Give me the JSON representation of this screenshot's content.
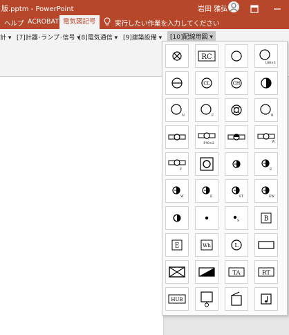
{
  "window": {
    "doc_title": "版.pptm  -  PowerPoint",
    "user_name": "岩田 雅弘"
  },
  "tabs": [
    {
      "label": "ヘルプ"
    },
    {
      "label": "ACROBAT"
    },
    {
      "label": "電気図記号"
    }
  ],
  "tell_me": "実行したい作業を入力してください",
  "ribbon_groups": [
    {
      "label": "計 ▾"
    },
    {
      "label": "[7]計器･ランプ･信号 ▾"
    },
    {
      "label": "[8]電気通信 ▾"
    },
    {
      "label": "[9]建築設備 ▾"
    },
    {
      "label": "[10]配線用図 ▾"
    }
  ],
  "symbol_labels": {
    "rc": "RC",
    "n100x3": "100×3",
    "cl": "CL",
    "ch": "CH",
    "sub_n": "N",
    "sub_f": "F",
    "sub_r": "R",
    "f40x2": "F40×2",
    "sub_w": "W",
    "sub_e": "E",
    "sub_et": "ET",
    "sub_ew": "EW",
    "sub_s": "S",
    "b": "B",
    "e": "E",
    "wh": "Wh",
    "l": "L",
    "ta": "TA",
    "rt": "RT",
    "hub": "HUB"
  },
  "colors": {
    "accent": "#b7472a",
    "ribbon": "#f3f3f3"
  }
}
